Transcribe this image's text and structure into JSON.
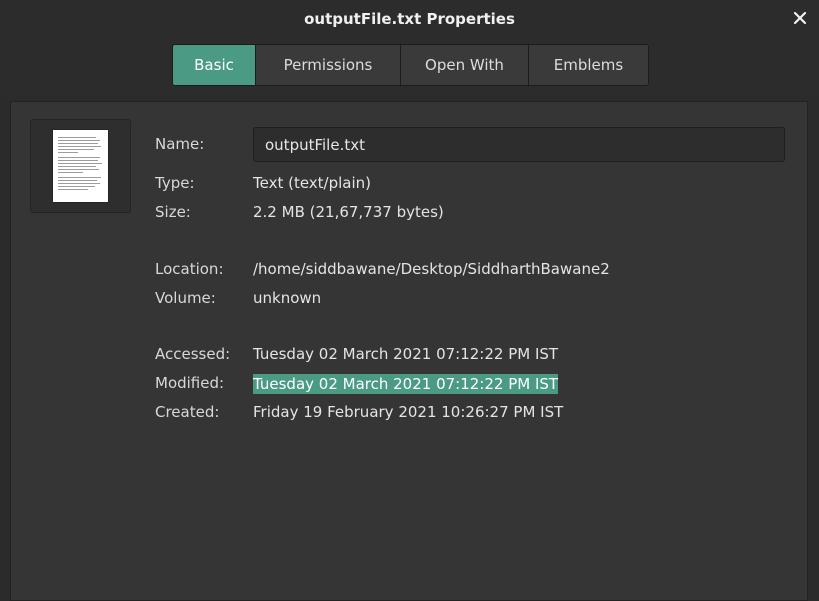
{
  "window": {
    "title": "outputFile.txt Properties"
  },
  "tabs": [
    {
      "label": "Basic",
      "active": true
    },
    {
      "label": "Permissions",
      "active": false
    },
    {
      "label": "Open With",
      "active": false
    },
    {
      "label": "Emblems",
      "active": false
    }
  ],
  "basic": {
    "name_label": "Name:",
    "name_value": "outputFile.txt",
    "type_label": "Type:",
    "type_value": "Text (text/plain)",
    "size_label": "Size:",
    "size_value": "2.2 MB (21,67,737 bytes)",
    "location_label": "Location:",
    "location_value": "/home/siddbawane/Desktop/SiddharthBawane2",
    "volume_label": "Volume:",
    "volume_value": "unknown",
    "accessed_label": "Accessed:",
    "accessed_value": "Tuesday 02 March 2021 07:12:22 PM IST",
    "modified_label": "Modified:",
    "modified_value": "Tuesday 02 March 2021 07:12:22 PM IST",
    "created_label": "Created:",
    "created_value": "Friday 19 February 2021 10:26:27 PM IST"
  },
  "icons": {
    "close": "close-icon",
    "file_thumbnail": "text-file-icon"
  },
  "colors": {
    "accent": "#4a9a84",
    "background": "#2b2b2b",
    "panel": "#353535"
  }
}
